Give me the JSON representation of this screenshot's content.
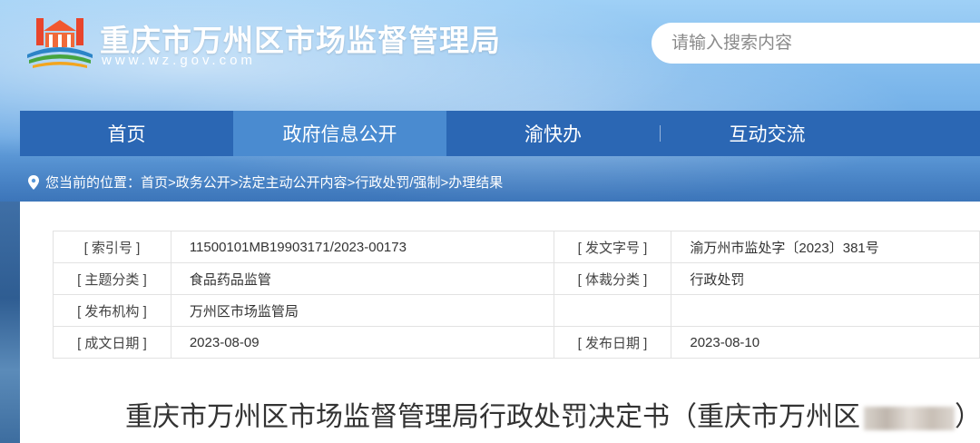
{
  "header": {
    "title": "重庆市万州区市场监督管理局",
    "url": "www.wz.gov.com",
    "search_placeholder": "请输入搜索内容"
  },
  "nav": {
    "items": [
      {
        "label": "首页"
      },
      {
        "label": "政府信息公开"
      },
      {
        "label": "渝快办"
      },
      {
        "label": "互动交流"
      }
    ]
  },
  "breadcrumb": {
    "prefix": "您当前的位置：",
    "items": [
      "首页",
      ">政务公开",
      ">法定主动公开内容",
      ">行政处罚/强制",
      ">办理结果"
    ]
  },
  "meta": {
    "rows": [
      {
        "l1": "[ 索引号 ]",
        "v1": "11500101MB19903171/2023-00173",
        "l2": "[ 发文字号 ]",
        "v2": "渝万州市监处字〔2023〕381号"
      },
      {
        "l1": "[ 主题分类 ]",
        "v1": "食品药品监管",
        "l2": "[ 体裁分类 ]",
        "v2": "行政处罚"
      },
      {
        "l1": "[ 发布机构 ]",
        "v1": "万州区市场监管局",
        "l2": "",
        "v2": ""
      },
      {
        "l1": "[ 成文日期 ]",
        "v1": "2023-08-09",
        "l2": "[ 发布日期 ]",
        "v2": "2023-08-10"
      }
    ]
  },
  "document": {
    "title": "重庆市万州区市场监督管理局行政处罚决定书（重庆市万州区",
    "title_suffix": "）"
  },
  "icons": {
    "logo": "government-building-logo",
    "pin": "location-pin-icon"
  }
}
